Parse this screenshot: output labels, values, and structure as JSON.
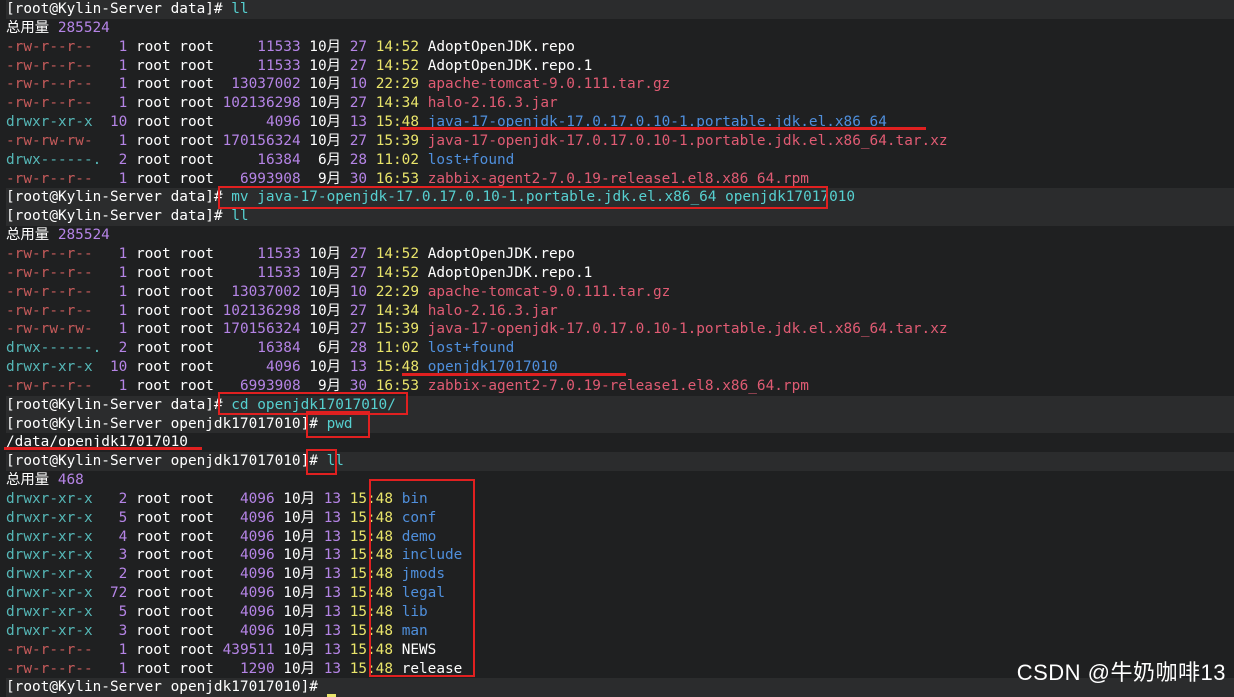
{
  "terminal": {
    "prompt1": {
      "bracket": "[root@Kylin-Server data]# ",
      "cmd": "ll"
    },
    "total1": {
      "label": "总用量",
      "value": "285524"
    },
    "listing1": [
      {
        "perm": "-rw-r--r--",
        "n": "1",
        "owner": "root root",
        "size": "11533",
        "mon": "10月",
        "day": "27",
        "time": "14:52",
        "name": "AdoptOpenJDK.repo",
        "kind": "repo"
      },
      {
        "perm": "-rw-r--r--",
        "n": "1",
        "owner": "root root",
        "size": "11533",
        "mon": "10月",
        "day": "27",
        "time": "14:52",
        "name": "AdoptOpenJDK.repo.1",
        "kind": "repo"
      },
      {
        "perm": "-rw-r--r--",
        "n": "1",
        "owner": "root root",
        "size": "13037002",
        "mon": "10月",
        "day": "10",
        "time": "22:29",
        "name": "apache-tomcat-9.0.111.tar.gz",
        "kind": "arch"
      },
      {
        "perm": "-rw-r--r--",
        "n": "1",
        "owner": "root root",
        "size": "102136298",
        "mon": "10月",
        "day": "27",
        "time": "14:34",
        "name": "halo-2.16.3.jar",
        "kind": "arch"
      },
      {
        "perm": "drwxr-xr-x",
        "n": "10",
        "owner": "root root",
        "size": "4096",
        "mon": "10月",
        "day": "13",
        "time": "15:48",
        "name": "java-17-openjdk-17.0.17.0.10-1.portable.jdk.el.x86_64",
        "kind": "dir"
      },
      {
        "perm": "-rw-rw-rw-",
        "n": "1",
        "owner": "root root",
        "size": "170156324",
        "mon": "10月",
        "day": "27",
        "time": "15:39",
        "name": "java-17-openjdk-17.0.17.0.10-1.portable.jdk.el.x86_64.tar.xz",
        "kind": "arch"
      },
      {
        "perm": "drwx------.",
        "n": "2",
        "owner": "root root",
        "size": "16384",
        "mon": "6月",
        "day": "28",
        "time": "11:02",
        "name": "lost+found",
        "kind": "dir"
      },
      {
        "perm": "-rw-r--r--",
        "n": "1",
        "owner": "root root",
        "size": "6993908",
        "mon": "9月",
        "day": "30",
        "time": "16:53",
        "name": "zabbix-agent2-7.0.19-release1.el8.x86_64.rpm",
        "kind": "arch"
      }
    ],
    "prompt2": {
      "bracket": "[root@Kylin-Server data]# ",
      "cmd": "mv java-17-openjdk-17.0.17.0.10-1.portable.jdk.el.x86_64 openjdk17017010"
    },
    "prompt3": {
      "bracket": "[root@Kylin-Server data]# ",
      "cmd": "ll"
    },
    "total2": {
      "label": "总用量",
      "value": "285524"
    },
    "listing2": [
      {
        "perm": "-rw-r--r--",
        "n": "1",
        "owner": "root root",
        "size": "11533",
        "mon": "10月",
        "day": "27",
        "time": "14:52",
        "name": "AdoptOpenJDK.repo",
        "kind": "repo"
      },
      {
        "perm": "-rw-r--r--",
        "n": "1",
        "owner": "root root",
        "size": "11533",
        "mon": "10月",
        "day": "27",
        "time": "14:52",
        "name": "AdoptOpenJDK.repo.1",
        "kind": "repo"
      },
      {
        "perm": "-rw-r--r--",
        "n": "1",
        "owner": "root root",
        "size": "13037002",
        "mon": "10月",
        "day": "10",
        "time": "22:29",
        "name": "apache-tomcat-9.0.111.tar.gz",
        "kind": "arch"
      },
      {
        "perm": "-rw-r--r--",
        "n": "1",
        "owner": "root root",
        "size": "102136298",
        "mon": "10月",
        "day": "27",
        "time": "14:34",
        "name": "halo-2.16.3.jar",
        "kind": "arch"
      },
      {
        "perm": "-rw-rw-rw-",
        "n": "1",
        "owner": "root root",
        "size": "170156324",
        "mon": "10月",
        "day": "27",
        "time": "15:39",
        "name": "java-17-openjdk-17.0.17.0.10-1.portable.jdk.el.x86_64.tar.xz",
        "kind": "arch"
      },
      {
        "perm": "drwx------.",
        "n": "2",
        "owner": "root root",
        "size": "16384",
        "mon": "6月",
        "day": "28",
        "time": "11:02",
        "name": "lost+found",
        "kind": "dir"
      },
      {
        "perm": "drwxr-xr-x",
        "n": "10",
        "owner": "root root",
        "size": "4096",
        "mon": "10月",
        "day": "13",
        "time": "15:48",
        "name": "openjdk17017010",
        "kind": "dir"
      },
      {
        "perm": "-rw-r--r--",
        "n": "1",
        "owner": "root root",
        "size": "6993908",
        "mon": "9月",
        "day": "30",
        "time": "16:53",
        "name": "zabbix-agent2-7.0.19-release1.el8.x86_64.rpm",
        "kind": "arch"
      }
    ],
    "prompt4": {
      "bracket": "[root@Kylin-Server data]# ",
      "cmd": "cd openjdk17017010/"
    },
    "prompt5": {
      "bracket": "[root@Kylin-Server openjdk17017010]# ",
      "cmd": "pwd"
    },
    "pwd_output": "/data/openjdk17017010",
    "prompt6": {
      "bracket": "[root@Kylin-Server openjdk17017010]# ",
      "cmd": "ll"
    },
    "total3": {
      "label": "总用量",
      "value": "468"
    },
    "listing3": [
      {
        "perm": "drwxr-xr-x",
        "n": "2",
        "owner": "root root",
        "size": "4096",
        "mon": "10月",
        "day": "13",
        "time": "15:48",
        "name": "bin",
        "kind": "dir"
      },
      {
        "perm": "drwxr-xr-x",
        "n": "5",
        "owner": "root root",
        "size": "4096",
        "mon": "10月",
        "day": "13",
        "time": "15:48",
        "name": "conf",
        "kind": "dir"
      },
      {
        "perm": "drwxr-xr-x",
        "n": "4",
        "owner": "root root",
        "size": "4096",
        "mon": "10月",
        "day": "13",
        "time": "15:48",
        "name": "demo",
        "kind": "dir"
      },
      {
        "perm": "drwxr-xr-x",
        "n": "3",
        "owner": "root root",
        "size": "4096",
        "mon": "10月",
        "day": "13",
        "time": "15:48",
        "name": "include",
        "kind": "dir"
      },
      {
        "perm": "drwxr-xr-x",
        "n": "2",
        "owner": "root root",
        "size": "4096",
        "mon": "10月",
        "day": "13",
        "time": "15:48",
        "name": "jmods",
        "kind": "dir"
      },
      {
        "perm": "drwxr-xr-x",
        "n": "72",
        "owner": "root root",
        "size": "4096",
        "mon": "10月",
        "day": "13",
        "time": "15:48",
        "name": "legal",
        "kind": "dir"
      },
      {
        "perm": "drwxr-xr-x",
        "n": "5",
        "owner": "root root",
        "size": "4096",
        "mon": "10月",
        "day": "13",
        "time": "15:48",
        "name": "lib",
        "kind": "dir"
      },
      {
        "perm": "drwxr-xr-x",
        "n": "3",
        "owner": "root root",
        "size": "4096",
        "mon": "10月",
        "day": "13",
        "time": "15:48",
        "name": "man",
        "kind": "dir"
      },
      {
        "perm": "-rw-r--r--",
        "n": "1",
        "owner": "root root",
        "size": "439511",
        "mon": "10月",
        "day": "13",
        "time": "15:48",
        "name": "NEWS",
        "kind": "plain"
      },
      {
        "perm": "-rw-r--r--",
        "n": "1",
        "owner": "root root",
        "size": "1290",
        "mon": "10月",
        "day": "13",
        "time": "15:48",
        "name": "release",
        "kind": "plain"
      }
    ],
    "prompt7": {
      "bracket": "[root@Kylin-Server openjdk17017010]# ",
      "cmd": ""
    }
  },
  "watermark": "CSDN @牛奶咖啡13",
  "colors": {
    "background": "#1f2021",
    "annotation_red": "#e02020",
    "perm_file": "#c75b5b",
    "perm_dir": "#56b8b8",
    "number": "#b584e6",
    "time": "#e9e46a",
    "dir_name": "#4f8fdc",
    "archive_name": "#e05b73",
    "command": "#56d0d0"
  }
}
